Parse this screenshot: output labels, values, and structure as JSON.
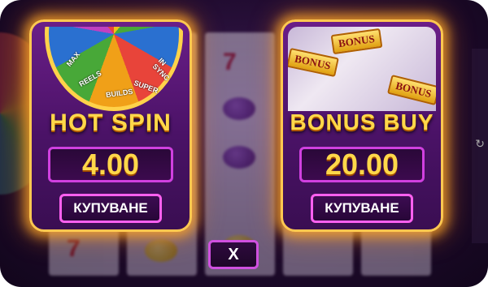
{
  "hot_spin": {
    "title": "HOT SPIN",
    "price": "4.00",
    "buy_label": "КУПУВАНЕ",
    "wheel_labels": [
      "MAX",
      "REELS",
      "BUILDS",
      "SUPER",
      "IN SYNC"
    ]
  },
  "bonus_buy": {
    "title": "BONUS BUY",
    "price": "20.00",
    "buy_label": "КУПУВАНЕ",
    "tile_text": "BONUS"
  },
  "close_button": {
    "label": "X"
  },
  "colors": {
    "card_glow": "#ffaa28",
    "title_gold": "#ffd84a",
    "button_border": "#ff60f0",
    "card_purple": "#5a1a7a"
  },
  "icons": {
    "rotate": "rotate-icon"
  }
}
